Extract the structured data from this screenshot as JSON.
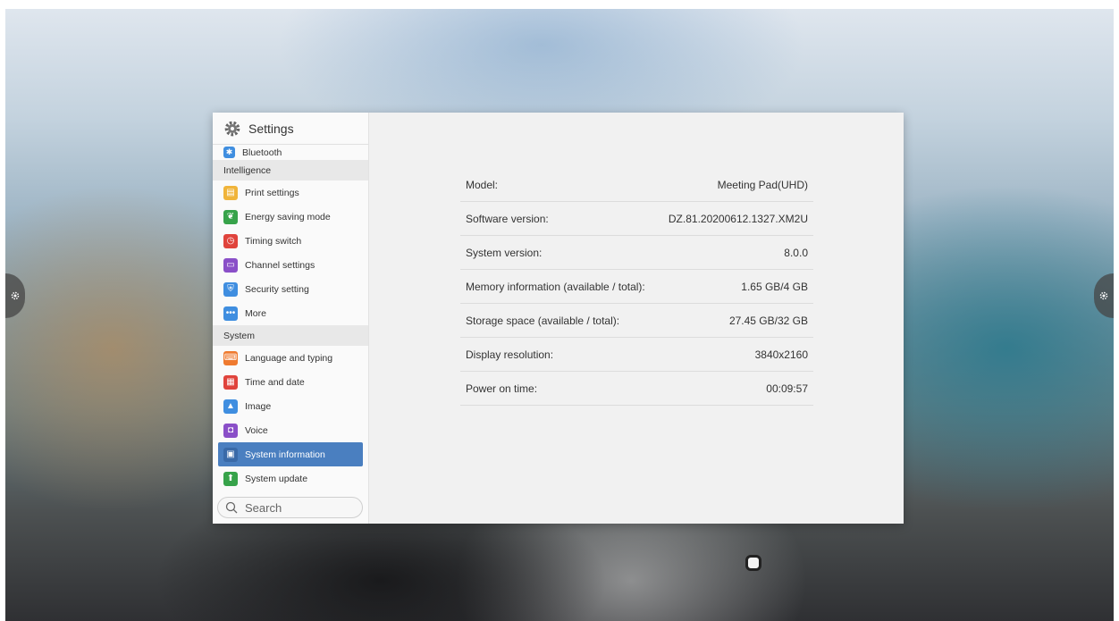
{
  "window": {
    "title": "Settings"
  },
  "sidebar": {
    "items_top": [
      {
        "label": "Bluetooth",
        "icon": "bluetooth-icon",
        "color": "#3f8ee0"
      }
    ],
    "sections": [
      {
        "label": "Intelligence",
        "items": [
          {
            "label": "Print settings",
            "icon": "printer-icon",
            "color": "#f0b43a"
          },
          {
            "label": "Energy saving mode",
            "icon": "leaf-icon",
            "color": "#37a34a"
          },
          {
            "label": "Timing switch",
            "icon": "clock-icon",
            "color": "#e0433c"
          },
          {
            "label": "Channel settings",
            "icon": "monitor-icon",
            "color": "#8a4fc8"
          },
          {
            "label": "Security setting",
            "icon": "shield-icon",
            "color": "#3f8ee0"
          },
          {
            "label": "More",
            "icon": "more-dots-icon",
            "color": "#3f8ee0"
          }
        ]
      },
      {
        "label": "System",
        "items": [
          {
            "label": "Language and typing",
            "icon": "keyboard-icon",
            "color": "#ef7a2f"
          },
          {
            "label": "Time and date",
            "icon": "calendar-icon",
            "color": "#e0433c"
          },
          {
            "label": "Image",
            "icon": "image-icon",
            "color": "#3f8ee0"
          },
          {
            "label": "Voice",
            "icon": "speaker-icon",
            "color": "#8a4fc8"
          },
          {
            "label": "System information",
            "icon": "info-card-icon",
            "color": "#4a7fc0",
            "selected": true
          },
          {
            "label": "System update",
            "icon": "upload-arrow-icon",
            "color": "#37a34a"
          }
        ]
      }
    ],
    "search": {
      "placeholder": "Search"
    }
  },
  "system_info": {
    "rows": [
      {
        "label": "Model:",
        "value": "Meeting Pad(UHD)"
      },
      {
        "label": "Software version:",
        "value": "DZ.81.20200612.1327.XM2U"
      },
      {
        "label": "System version:",
        "value": "8.0.0"
      },
      {
        "label": "Memory information (available / total):",
        "value": "1.65 GB/4 GB"
      },
      {
        "label": "Storage space (available / total):",
        "value": "27.45 GB/32 GB"
      },
      {
        "label": "Display resolution:",
        "value": "3840x2160"
      },
      {
        "label": "Power on time:",
        "value": "00:09:57"
      }
    ]
  },
  "colors": {
    "accent": "#4a7fc0"
  }
}
